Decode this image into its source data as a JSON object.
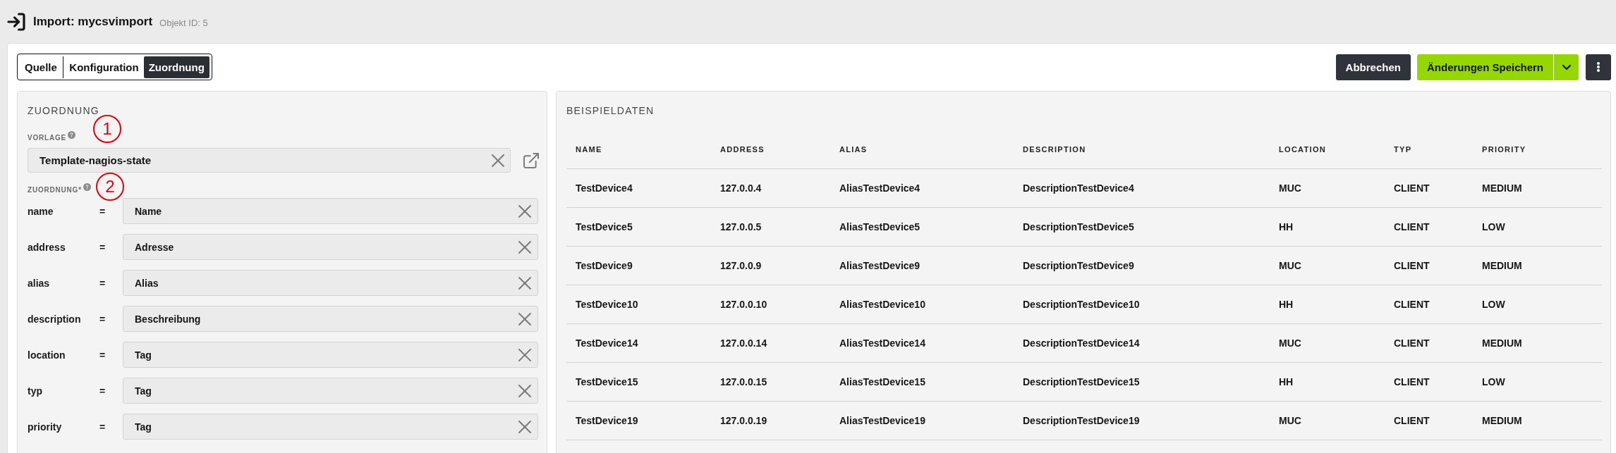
{
  "header": {
    "title": "Import: mycsvimport",
    "object_id": "Objekt ID: 5"
  },
  "tabs": [
    {
      "label": "Quelle",
      "selected": false
    },
    {
      "label": "Konfiguration",
      "selected": false
    },
    {
      "label": "Zuordnung",
      "selected": true
    }
  ],
  "actions": {
    "cancel": "Abbrechen",
    "save": "Änderungen Speichern"
  },
  "mapping_panel": {
    "title": "ZUORDNUNG",
    "template": {
      "label": "VORLAGE",
      "callout": "1",
      "value": "Template-nagios-state"
    },
    "mapping": {
      "label": "ZUORDNUNG*",
      "callout": "2",
      "rows": [
        {
          "field": "name",
          "operator": "=",
          "value": "Name"
        },
        {
          "field": "address",
          "operator": "=",
          "value": "Adresse"
        },
        {
          "field": "alias",
          "operator": "=",
          "value": "Alias"
        },
        {
          "field": "description",
          "operator": "=",
          "value": "Beschreibung"
        },
        {
          "field": "location",
          "operator": "=",
          "value": "Tag"
        },
        {
          "field": "typ",
          "operator": "=",
          "value": "Tag"
        },
        {
          "field": "priority",
          "operator": "=",
          "value": "Tag"
        }
      ]
    }
  },
  "sample_panel": {
    "title": "BEISPIELDATEN",
    "table": {
      "columns": [
        "NAME",
        "ADDRESS",
        "ALIAS",
        "DESCRIPTION",
        "LOCATION",
        "TYP",
        "PRIORITY"
      ],
      "rows": [
        [
          "TestDevice4",
          "127.0.0.4",
          "AliasTestDevice4",
          "DescriptionTestDevice4",
          "MUC",
          "CLIENT",
          "MEDIUM"
        ],
        [
          "TestDevice5",
          "127.0.0.5",
          "AliasTestDevice5",
          "DescriptionTestDevice5",
          "HH",
          "CLIENT",
          "LOW"
        ],
        [
          "TestDevice9",
          "127.0.0.9",
          "AliasTestDevice9",
          "DescriptionTestDevice9",
          "MUC",
          "CLIENT",
          "MEDIUM"
        ],
        [
          "TestDevice10",
          "127.0.0.10",
          "AliasTestDevice10",
          "DescriptionTestDevice10",
          "HH",
          "CLIENT",
          "LOW"
        ],
        [
          "TestDevice14",
          "127.0.0.14",
          "AliasTestDevice14",
          "DescriptionTestDevice14",
          "MUC",
          "CLIENT",
          "MEDIUM"
        ],
        [
          "TestDevice15",
          "127.0.0.15",
          "AliasTestDevice15",
          "DescriptionTestDevice15",
          "HH",
          "CLIENT",
          "LOW"
        ],
        [
          "TestDevice19",
          "127.0.0.19",
          "AliasTestDevice19",
          "DescriptionTestDevice19",
          "MUC",
          "CLIENT",
          "MEDIUM"
        ]
      ]
    }
  }
}
